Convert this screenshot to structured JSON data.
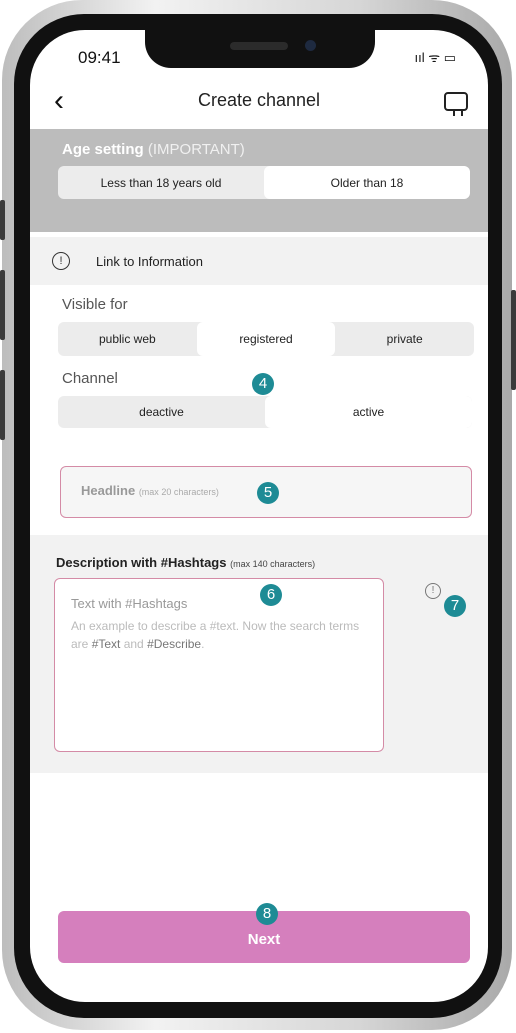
{
  "status": {
    "time": "09:41",
    "icons": "ııl ᯤ ▭"
  },
  "header": {
    "title": "Create channel",
    "back": "‹"
  },
  "age": {
    "title": "Age setting",
    "note": "(IMPORTANT)",
    "options": [
      "Less than 18 years old",
      "Older than 18"
    ],
    "selected": "Older than 18"
  },
  "info": {
    "icon": "!",
    "label": "Link to Information"
  },
  "visible": {
    "label": "Visible for",
    "options": [
      "public web",
      "registered",
      "private"
    ],
    "selected": "registered"
  },
  "channel": {
    "label": "Channel",
    "options": [
      "deactive",
      "active"
    ],
    "selected": "active"
  },
  "headline": {
    "placeholder": "Headline",
    "hint": "(max 20 characters)"
  },
  "description": {
    "label": "Description with #Hashtags",
    "hint": "(max 140 characters)",
    "placeholder_title": "Text with #Hashtags",
    "placeholder_body_1": "An example to describe a #text. Now the search terms are ",
    "tag1": "#Text",
    "and": " and ",
    "tag2": "#Describe",
    "period": ".",
    "info_icon": "!"
  },
  "next_label": "Next",
  "badges": {
    "b4": "4",
    "b5": "5",
    "b6": "6",
    "b7": "7",
    "b8": "8"
  },
  "colors": {
    "accent": "#d57fbd",
    "badge": "#1e8b95",
    "border": "#d48ba6",
    "band": "#bcbcbc"
  },
  "icons": {
    "back": "chevron-left-icon",
    "monitor": "monitor-icon",
    "info": "info-icon"
  }
}
